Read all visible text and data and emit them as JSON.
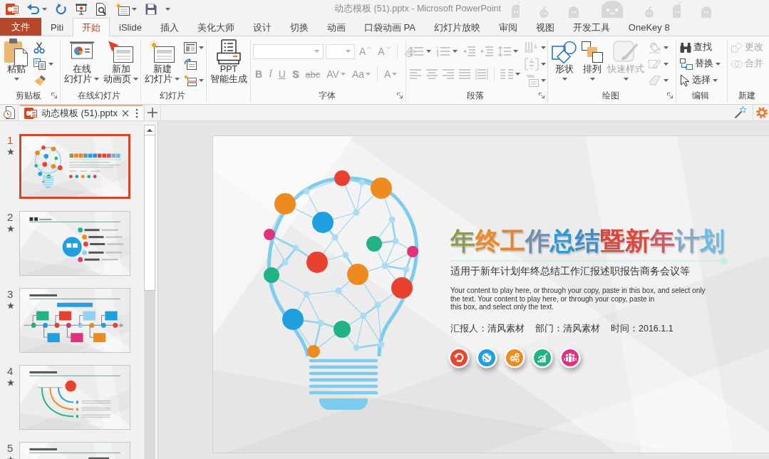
{
  "window": {
    "title": "动态模板 (51).pptx - Microsoft PowerPoint"
  },
  "quick_access": [
    {
      "dropdown": false
    },
    {
      "dropdown": true
    },
    {
      "dropdown": false
    },
    {
      "dropdown": false
    },
    {
      "dropdown": false
    },
    {
      "dropdown": true
    },
    {
      "dropdown": false
    }
  ],
  "ribbon_tabs": [
    {
      "label": "文件",
      "kind": "file",
      "selected": false
    },
    {
      "label": "Piti",
      "kind": "tab",
      "selected": false
    },
    {
      "label": "开始",
      "kind": "tab",
      "selected": true
    },
    {
      "label": "iSlide",
      "kind": "tab",
      "selected": false
    },
    {
      "label": "插入",
      "kind": "tab",
      "selected": false
    },
    {
      "label": "美化大师",
      "kind": "tab",
      "selected": false
    },
    {
      "label": "设计",
      "kind": "tab",
      "selected": false
    },
    {
      "label": "切换",
      "kind": "tab",
      "selected": false
    },
    {
      "label": "动画",
      "kind": "tab",
      "selected": false
    },
    {
      "label": "口袋动画 PA",
      "kind": "tab",
      "selected": false
    },
    {
      "label": "幻灯片放映",
      "kind": "tab",
      "selected": false
    },
    {
      "label": "审阅",
      "kind": "tab",
      "selected": false
    },
    {
      "label": "视图",
      "kind": "tab",
      "selected": false
    },
    {
      "label": "开发工具",
      "kind": "tab",
      "selected": false
    },
    {
      "label": "OneKey 8",
      "kind": "tab",
      "selected": false
    }
  ],
  "ribbon_groups": [
    {
      "label": "剪贴板",
      "launcher": true,
      "sections": [
        {
          "kind": "large",
          "items": [
            {
              "lines": [
                "粘贴"
              ],
              "dropdown": true,
              "disabled": false
            }
          ]
        },
        {
          "kind": "stack",
          "items": [
            {
              "dropdown": false,
              "disabled": false
            },
            {
              "dropdown": true,
              "disabled": false
            },
            {
              "dropdown": false,
              "disabled": false
            }
          ]
        }
      ]
    },
    {
      "label": "在线幻灯片",
      "sections": [
        {
          "kind": "large",
          "items": [
            {
              "lines": [
                "在线",
                "幻灯片"
              ],
              "dropdown": true,
              "disabled": false
            },
            {
              "lines": [
                "新加",
                "动画页"
              ],
              "dropdown": true,
              "disabled": false
            }
          ]
        }
      ]
    },
    {
      "label": "幻灯片",
      "sections": [
        {
          "kind": "large",
          "items": [
            {
              "lines": [
                "新建",
                "幻灯片"
              ],
              "dropdown": true,
              "disabled": false
            }
          ]
        },
        {
          "kind": "stack",
          "items": [
            {
              "dropdown": true,
              "disabled": false
            },
            {
              "dropdown": false,
              "disabled": false
            },
            {
              "dropdown": true,
              "disabled": false
            }
          ]
        }
      ]
    },
    {
      "sections": [
        {
          "kind": "large",
          "items": [
            {
              "lines": [
                "PPT",
                "智能生成"
              ],
              "dropdown": false,
              "disabled": false
            }
          ]
        }
      ]
    },
    {
      "label": "字体",
      "launcher": true,
      "sections": [
        {
          "kind": "strips",
          "top": [
            {
              "kind": "field",
              "dropdown": true,
              "disabled": true
            },
            {
              "kind": "field",
              "dropdown": true,
              "disabled": true
            },
            {
              "kind": "text",
              "label": "A",
              "dropdown": false,
              "disabled": true
            },
            {
              "kind": "text",
              "label": "A",
              "dropdown": false,
              "disabled": true
            },
            {
              "kind": "icon",
              "dropdown": false,
              "disabled": true
            }
          ],
          "bottom": [
            {
              "kind": "text",
              "label": "B",
              "dropdown": false,
              "disabled": true
            },
            {
              "kind": "text",
              "label": "I",
              "dropdown": false,
              "disabled": true
            },
            {
              "kind": "text",
              "label": "U",
              "dropdown": false,
              "disabled": true
            },
            {
              "kind": "text",
              "label": "S",
              "dropdown": false,
              "disabled": true
            },
            {
              "kind": "text",
              "label": "abc",
              "dropdown": false,
              "disabled": true
            },
            {
              "kind": "text",
              "label": "AV",
              "dropdown": true,
              "disabled": true
            },
            {
              "kind": "text",
              "label": "Aa",
              "dropdown": true,
              "disabled": true
            },
            {
              "kind": "text",
              "label": "A",
              "dropdown": true,
              "disabled": true
            }
          ]
        }
      ]
    },
    {
      "label": "段落",
      "launcher": true,
      "sections": [
        {
          "kind": "strips",
          "top": [
            {
              "kind": "icon",
              "dropdown": true,
              "disabled": true
            },
            {
              "kind": "icon",
              "dropdown": true,
              "disabled": true
            },
            {
              "kind": "icon",
              "dropdown": false,
              "disabled": true
            },
            {
              "kind": "icon",
              "dropdown": false,
              "disabled": true
            },
            {
              "kind": "icon",
              "dropdown": true,
              "disabled": true
            }
          ],
          "bottom": [
            {
              "kind": "icon",
              "dropdown": false,
              "disabled": true
            },
            {
              "kind": "icon",
              "dropdown": false,
              "disabled": true
            },
            {
              "kind": "icon",
              "dropdown": false,
              "disabled": true
            },
            {
              "kind": "icon",
              "dropdown": false,
              "disabled": true
            },
            {
              "kind": "icon",
              "dropdown": false,
              "disabled": true
            },
            {
              "kind": "icon",
              "dropdown": true,
              "disabled": true
            }
          ]
        },
        {
          "kind": "stack",
          "items": [
            {
              "dropdown": true,
              "disabled": true
            },
            {
              "dropdown": true,
              "disabled": true
            },
            {
              "dropdown": true,
              "disabled": true
            }
          ]
        }
      ]
    },
    {
      "label": "绘图",
      "launcher": true,
      "sections": [
        {
          "kind": "large",
          "items": [
            {
              "lines": [
                "形状"
              ],
              "dropdown": true,
              "disabled": false
            },
            {
              "lines": [
                "排列"
              ],
              "dropdown": true,
              "disabled": false
            },
            {
              "lines": [
                "快速样式"
              ],
              "dropdown": true,
              "disabled": true
            }
          ]
        },
        {
          "kind": "stack",
          "items": [
            {
              "dropdown": true,
              "disabled": true
            },
            {
              "dropdown": true,
              "disabled": true
            },
            {
              "dropdown": true,
              "disabled": true
            }
          ]
        }
      ]
    },
    {
      "label": "编辑",
      "sections": [
        {
          "kind": "stack",
          "items": [
            {
              "label": "查找",
              "dropdown": false,
              "disabled": false
            },
            {
              "label": "替换",
              "dropdown": true,
              "disabled": false
            },
            {
              "label": "选择",
              "dropdown": true,
              "disabled": false
            }
          ]
        }
      ]
    },
    {
      "label": "新建",
      "sections": [
        {
          "kind": "stack",
          "items": [
            {
              "label": "更改",
              "dropdown": false,
              "disabled": true
            },
            {
              "label": "合并",
              "dropdown": false,
              "disabled": true
            }
          ]
        }
      ]
    }
  ],
  "document_tabs": [
    {
      "label": "动态模板 (51).pptx",
      "selected": true
    }
  ],
  "slides": [
    {
      "number": "1",
      "selected": true,
      "animated": true
    },
    {
      "number": "2",
      "selected": false,
      "animated": true
    },
    {
      "number": "3",
      "selected": false,
      "animated": true
    },
    {
      "number": "4",
      "selected": false,
      "animated": true
    },
    {
      "number": "5",
      "selected": false,
      "animated": true
    }
  ],
  "slide": {
    "title": "年终工作总结暨新年计划",
    "subtitle": "适用于新年计划年终总结工作汇报述职报告商务会议等",
    "body": "Your content to play here, or through your copy, paste in this box, and select only\nthe text. Your content to play here, or through your copy, paste in\nthis box, and select only the text.",
    "details": [
      "汇报人：清风素材",
      "部门：清风素材",
      "时间：2016.1.1"
    ],
    "icons": [
      {
        "color": "#e8472f"
      },
      {
        "color": "#1e9ee0"
      },
      {
        "color": "#ef8a1f"
      },
      {
        "color": "#22b287"
      },
      {
        "color": "#e0337f"
      }
    ]
  }
}
